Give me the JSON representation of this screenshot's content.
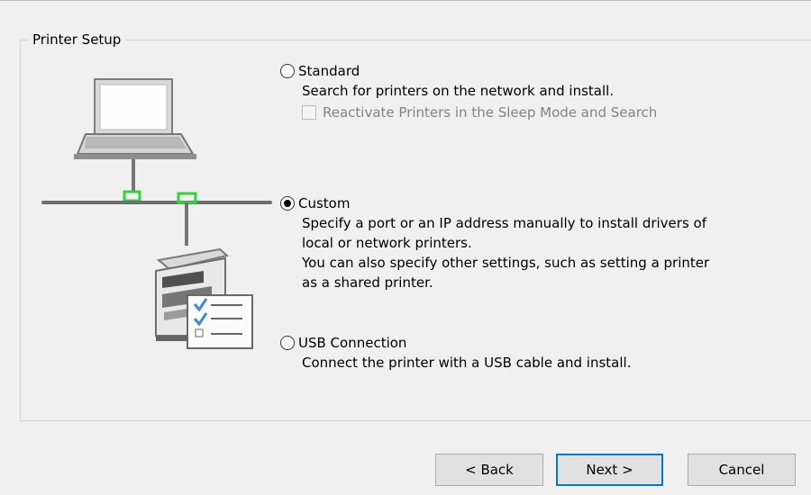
{
  "group": {
    "title": "Printer Setup"
  },
  "options": [
    {
      "label": "Standard",
      "selected": false,
      "description": "Search for printers on the network and install.",
      "checkbox": {
        "label": "Reactivate Printers in the Sleep Mode and Search",
        "checked": false,
        "enabled": false
      }
    },
    {
      "label": "Custom",
      "selected": true,
      "description": "Specify a port or an IP address manually to install drivers of\nlocal or network printers.\nYou can also specify other settings, such as setting a printer\nas a shared printer."
    },
    {
      "label": "USB Connection",
      "selected": false,
      "description": "Connect the printer with a USB cable and install."
    }
  ],
  "buttons": {
    "back": "< Back",
    "next": "Next >",
    "cancel": "Cancel"
  },
  "colors": {
    "default_button_border": "#0078d7",
    "network_link": "#2fd33c",
    "disabled_text": "#838383"
  },
  "icons": {
    "computer": "laptop-icon",
    "network": "network-line",
    "printer": "printer-icon",
    "settings": "settings-checklist-icon"
  }
}
